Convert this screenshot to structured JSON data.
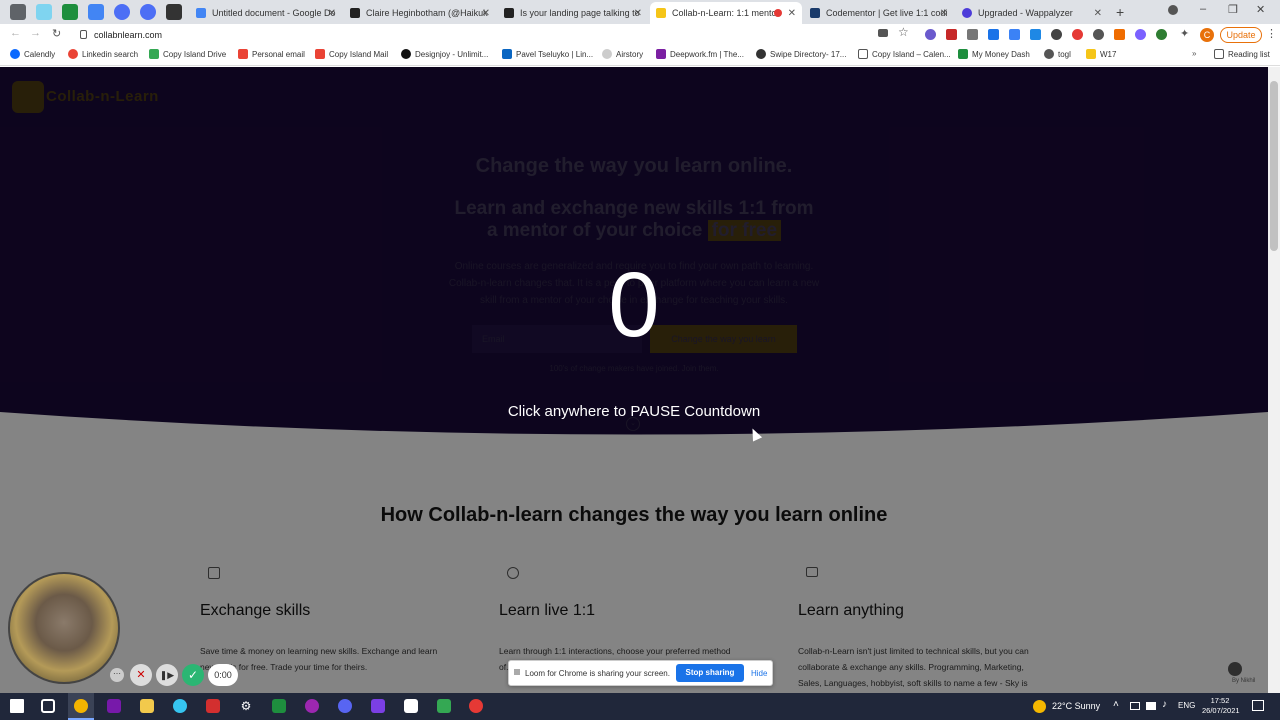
{
  "browser": {
    "tabs": [
      {
        "title": "",
        "color": "#5f6368"
      },
      {
        "title": "",
        "color": "#7fd4f0"
      },
      {
        "title": "",
        "color": "#1e8e3e"
      },
      {
        "title": "",
        "color": "#4285f4"
      },
      {
        "title": "",
        "color": "#4c6ef5"
      },
      {
        "title": "",
        "color": "#4c6ef5"
      },
      {
        "title": "",
        "color": "#333333"
      },
      {
        "title": "Untitled document - Google Do",
        "color": "#4285f4"
      },
      {
        "title": "Claire Heginbotham (@Haikuk",
        "color": "#222222"
      },
      {
        "title": "Is your landing page talking to",
        "color": "#222222"
      },
      {
        "title": "Collab-n-Learn: 1:1 mentor",
        "color": "#f5c518"
      },
      {
        "title": "Codementor | Get live 1:1 codi",
        "color": "#1a3b6b"
      },
      {
        "title": "Upgraded - Wappalyzer",
        "color": "#4c3bd9"
      }
    ],
    "url": "collabnlearn.com",
    "update_label": "Update",
    "profile_initial": "C",
    "bookmarks": [
      "Calendly",
      "Linkedin search",
      "Copy Island Drive",
      "Personal email",
      "Copy Island Mail",
      "Designjoy - Unlimit...",
      "Pavel Tseluyko | Lin...",
      "Airstory",
      "Deepwork.fm | The...",
      "Swipe Directory- 17...",
      "Copy Island – Calen...",
      "My Money Dash",
      "togl",
      "W17"
    ],
    "reading_list": "Reading list"
  },
  "site": {
    "logo": "Collab-n-Learn",
    "hero_title": "Change the way you learn online.",
    "hero_sub_line1": "Learn and exchange new skills 1:1 from",
    "hero_sub_line2": "a mentor of your choice",
    "hero_sub_highlight": "for free",
    "hero_desc_line1": "Online courses are generalized and require you to find your own path to learning.",
    "hero_desc_line2": "Collab-n-learn changes that. It is a peer to peer platform where you can learn a new",
    "hero_desc_line3": "skill from a mentor of your choice in exchange for teaching your skills.",
    "email_placeholder": "Email",
    "cta_label": "Change the way you learn",
    "joined_text": "100's of change makers have joined. Join them.",
    "section_title": "How Collab-n-learn changes the way you learn online",
    "features": [
      {
        "title": "Exchange skills",
        "desc1": "Save time & money on learning new skills. Exchange and learn",
        "desc2": "new skills for free. Trade your time for theirs."
      },
      {
        "title": "Learn live 1:1",
        "desc1": "Learn through 1:1 interactions, choose your preferred method",
        "desc2": "of..."
      },
      {
        "title": "Learn anything",
        "desc1": "Collab-n-Learn isn't just limited to technical skills, but you can",
        "desc2": "collaborate & exchange any skills. Programming, Marketing,",
        "desc3": "Sales, Languages, hobbyist, soft skills to name a few - Sky is"
      }
    ],
    "badge": "By Nikhil"
  },
  "overlay": {
    "countdown": "0",
    "pause_text": "Click anywhere to PAUSE Countdown",
    "timer": "0:00",
    "share_text": "Loom for Chrome is sharing your screen.",
    "stop_label": "Stop sharing",
    "hide_label": "Hide"
  },
  "taskbar": {
    "weather": "22°C  Sunny",
    "lang": "ENG",
    "time": "17:52",
    "date": "26/07/2021"
  },
  "colors": {
    "hero_bg": "#190a37",
    "accent": "#f5c518",
    "link": "#1a73e8"
  }
}
